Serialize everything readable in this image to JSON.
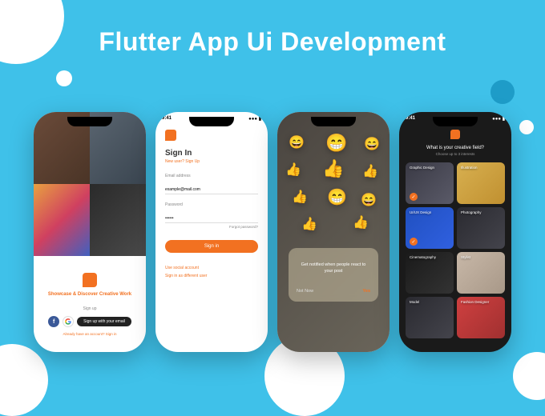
{
  "hero": {
    "title": "Flutter App Ui Development"
  },
  "status": {
    "time": "9:41"
  },
  "phone1": {
    "headline": "Showcase & Discover Creative Work",
    "signup_label": "Sign up",
    "email_btn": "Sign up with your email",
    "footer_prefix": "Already have an account? ",
    "footer_link": "Sign in"
  },
  "phone2": {
    "title": "Sign In",
    "sub_prefix": "New user? ",
    "sub_link": "Sign Up",
    "email_label": "Email address",
    "email_value": "example@mail.com",
    "pass_label": "Password",
    "forgot": "Forgot password?",
    "btn": "Sign in",
    "link1": "Use social account",
    "link2": "Sign in as different user"
  },
  "phone3": {
    "text": "Get notified when people react to your post",
    "not_now": "Not Now",
    "yes": "Yes"
  },
  "phone4": {
    "question": "What is your creative field?",
    "sub": "Choose up to 3 interests",
    "tiles": [
      {
        "label": "Graphic Design",
        "sub": ""
      },
      {
        "label": "Illustration",
        "sub": ""
      },
      {
        "label": "UI/UX Design",
        "sub": ""
      },
      {
        "label": "Photography",
        "sub": ""
      },
      {
        "label": "Cinematography",
        "sub": ""
      },
      {
        "label": "Stylist",
        "sub": ""
      },
      {
        "label": "Model",
        "sub": ""
      },
      {
        "label": "Fashion Designer",
        "sub": ""
      }
    ]
  }
}
